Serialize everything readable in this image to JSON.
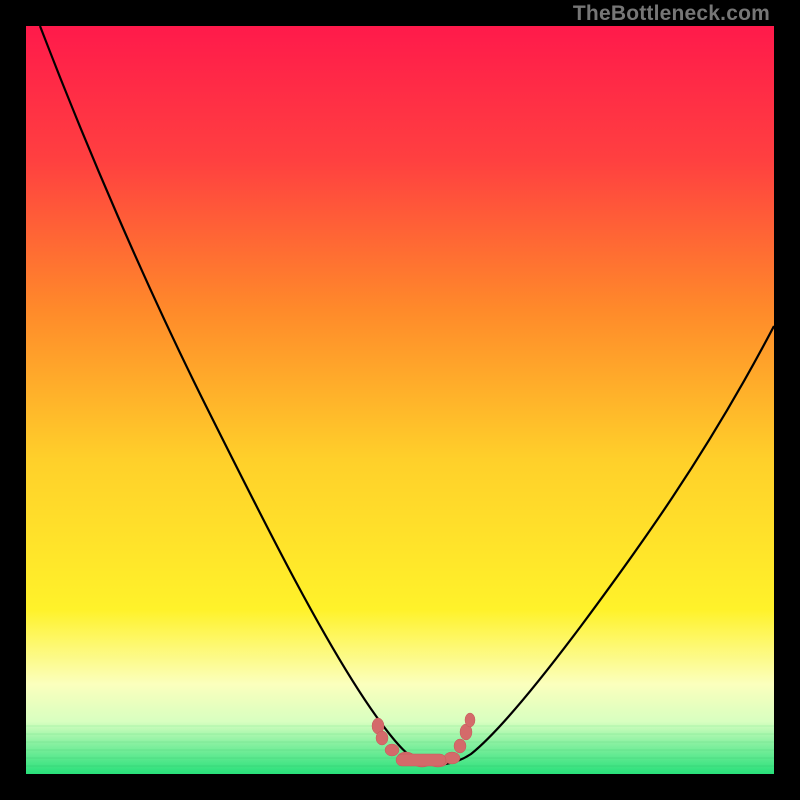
{
  "watermark": "TheBottleneck.com",
  "colors": {
    "gradient_top": "#ff1a4b",
    "gradient_mid1": "#ff7a2a",
    "gradient_mid2": "#ffe92a",
    "gradient_bottom_yellow": "#fbffbd",
    "gradient_green": "#28e07a",
    "curve": "#000000",
    "nodule": "#d46a6a",
    "frame": "#000000"
  },
  "chart_data": {
    "type": "line",
    "title": "",
    "xlabel": "",
    "ylabel": "",
    "xlim": [
      0,
      100
    ],
    "ylim": [
      0,
      100
    ],
    "series": [
      {
        "name": "bottleneck-curve",
        "x": [
          2,
          6,
          10,
          14,
          18,
          22,
          26,
          30,
          34,
          38,
          42,
          46,
          48,
          50,
          52,
          54,
          56,
          58,
          62,
          66,
          70,
          74,
          78,
          82,
          86,
          90,
          94,
          98,
          100
        ],
        "y": [
          100,
          92,
          84,
          76,
          68,
          60,
          52,
          44,
          36,
          28,
          20,
          12,
          8,
          4,
          2,
          1,
          1,
          2,
          5,
          10,
          16,
          22,
          28,
          34,
          40,
          46,
          52,
          58,
          61
        ]
      }
    ],
    "annotations": [
      {
        "name": "nodule-cluster",
        "x_range": [
          46,
          59
        ],
        "y_range": [
          0,
          5
        ]
      }
    ]
  }
}
